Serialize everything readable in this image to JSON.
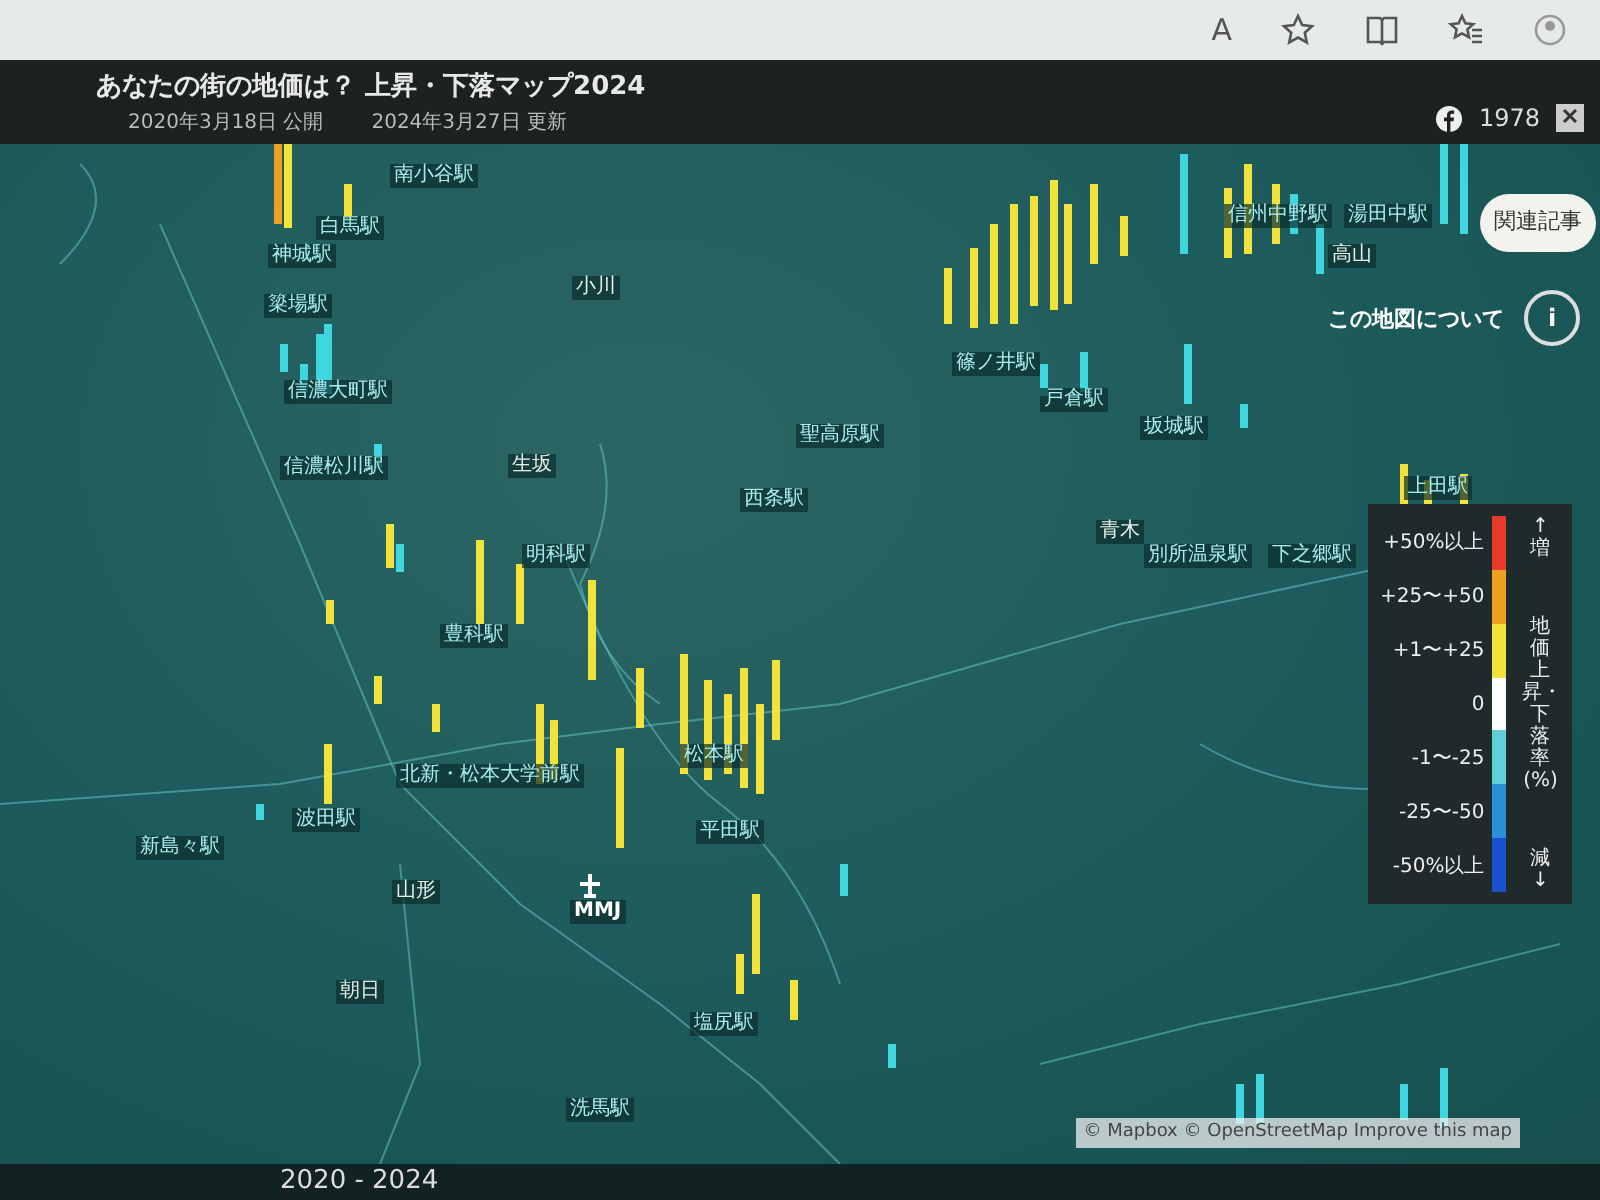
{
  "browser_toolbar": {
    "read_aloud_glyph": "A"
  },
  "header": {
    "title": "あなたの街の地価は？ 上昇・下落マップ2024",
    "published": "2020年3月18日 公開",
    "updated": "2024年3月27日 更新",
    "share_count": "1978"
  },
  "map": {
    "labels": [
      {
        "text": "南小谷駅",
        "kind": "station"
      },
      {
        "text": "白馬駅",
        "kind": "station"
      },
      {
        "text": "神城駅",
        "kind": "station"
      },
      {
        "text": "簗場駅",
        "kind": "station"
      },
      {
        "text": "信濃大町駅",
        "kind": "station"
      },
      {
        "text": "信濃松川駅",
        "kind": "station"
      },
      {
        "text": "小川",
        "kind": "place"
      },
      {
        "text": "生坂",
        "kind": "place"
      },
      {
        "text": "西条駅",
        "kind": "station"
      },
      {
        "text": "聖高原駅",
        "kind": "station"
      },
      {
        "text": "明科駅",
        "kind": "station"
      },
      {
        "text": "豊科駅",
        "kind": "station"
      },
      {
        "text": "北新・松本大学前駅",
        "kind": "station"
      },
      {
        "text": "松本駅",
        "kind": "station"
      },
      {
        "text": "平田駅",
        "kind": "station"
      },
      {
        "text": "波田駅",
        "kind": "station"
      },
      {
        "text": "新島々駅",
        "kind": "station"
      },
      {
        "text": "山形",
        "kind": "place"
      },
      {
        "text": "MMJ",
        "kind": "airport"
      },
      {
        "text": "朝日",
        "kind": "place"
      },
      {
        "text": "塩尻駅",
        "kind": "station"
      },
      {
        "text": "洗馬駅",
        "kind": "station"
      },
      {
        "text": "青木",
        "kind": "place"
      },
      {
        "text": "別所温泉駅",
        "kind": "station"
      },
      {
        "text": "下之郷駅",
        "kind": "station"
      },
      {
        "text": "上田駅",
        "kind": "station"
      },
      {
        "text": "坂城駅",
        "kind": "station"
      },
      {
        "text": "戸倉駅",
        "kind": "station"
      },
      {
        "text": "篠ノ井駅",
        "kind": "station"
      },
      {
        "text": "信州中野駅",
        "kind": "station"
      },
      {
        "text": "湯田中駅",
        "kind": "station"
      },
      {
        "text": "高山",
        "kind": "place"
      }
    ],
    "attribution": "© Mapbox © OpenStreetMap Improve this map",
    "related_button": "関連記事",
    "about_label": "この地図について",
    "info_button": "i",
    "years": "2020 - 2024"
  },
  "legend": {
    "top": "↑増",
    "axis_title": "地価上昇・下落率(%)",
    "bottom": "減↓",
    "items": [
      {
        "label": "+50%以上",
        "color": "#e8392a"
      },
      {
        "label": "+25〜+50",
        "color": "#f0a020"
      },
      {
        "label": "+1〜+25",
        "color": "#f2e23a"
      },
      {
        "label": "0",
        "color": "#ffffff"
      },
      {
        "label": "-1〜-25",
        "color": "#5fd0d8"
      },
      {
        "label": "-25〜-50",
        "color": "#2a90d8"
      },
      {
        "label": "-50%以上",
        "color": "#1a4fd0"
      }
    ]
  }
}
